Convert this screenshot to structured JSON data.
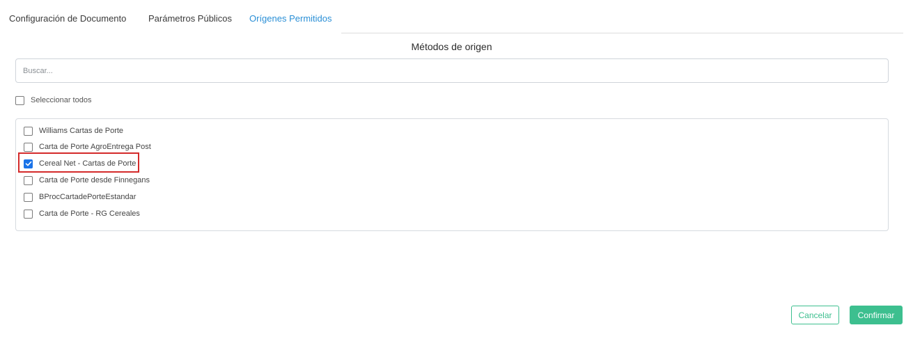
{
  "tabs": [
    {
      "label": "Configuración de Documento",
      "active": false
    },
    {
      "label": "Parámetros Públicos",
      "active": false
    },
    {
      "label": "Orígenes Permitidos",
      "active": true
    }
  ],
  "section_title": "Métodos de origen",
  "search": {
    "placeholder": "Buscar...",
    "value": ""
  },
  "select_all": {
    "label": "Seleccionar todos",
    "checked": false
  },
  "items": [
    {
      "label": "Williams Cartas de Porte",
      "checked": false
    },
    {
      "label": "Carta de Porte AgroEntrega Post",
      "checked": false
    },
    {
      "label": "Cereal Net - Cartas de Porte",
      "checked": true
    },
    {
      "label": "Carta de Porte desde Finnegans",
      "checked": false
    },
    {
      "label": "BProcCartadePorteEstandar",
      "checked": false
    },
    {
      "label": "Carta de Porte - RG Cereales",
      "checked": false
    }
  ],
  "buttons": {
    "cancel": "Cancelar",
    "confirm": "Confirmar"
  },
  "colors": {
    "accent_tab": "#2a8fd6",
    "button_green": "#3dbf8f",
    "checkbox_blue": "#1a73e8",
    "highlight_red": "#d42a2a"
  },
  "icons": {
    "checkbox_check": "check-icon"
  }
}
